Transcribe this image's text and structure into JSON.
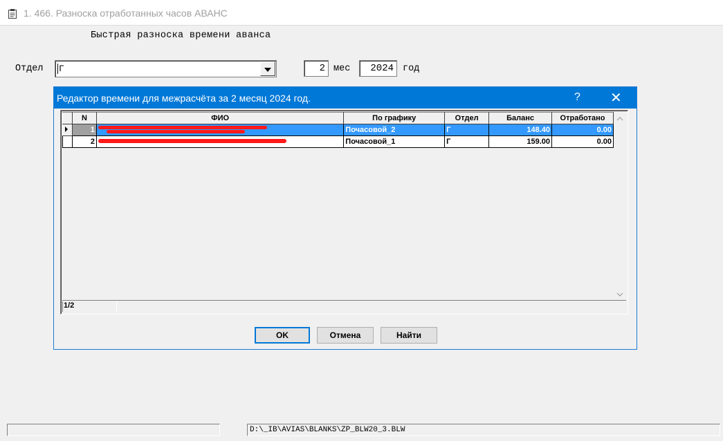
{
  "window": {
    "title": "1. 466. Разноска отработанных часов АВАНС",
    "icon": "document-icon"
  },
  "form": {
    "heading": "Быстрая разноска времени аванса",
    "dept_label": "Отдел",
    "dept_value": "Г",
    "month_value": "2",
    "month_label": "мес",
    "year_value": "2024",
    "year_label": "год"
  },
  "dialog": {
    "title": "Редактор времени для межрасчёта за 2 месяц 2024 год.",
    "help": "?",
    "close": "✕",
    "columns": [
      "N",
      "ФИО",
      "По графику",
      "Отдел",
      "Баланс",
      "Отработано"
    ],
    "rows": [
      {
        "n": "1",
        "fio": "",
        "schedule": "Почасовой_2",
        "dept": "Г",
        "balance": "148.40",
        "worked": "0.00"
      },
      {
        "n": "2",
        "fio": "",
        "schedule": "Почасовой_1",
        "dept": "Г",
        "balance": "159.00",
        "worked": "0.00"
      }
    ],
    "record_counter": "1/2",
    "buttons": {
      "ok": "OK",
      "cancel": "Отмена",
      "find": "Найти"
    }
  },
  "status": {
    "path": "D:\\_IB\\AVIAS\\BLANKS\\ZP_BLW20_3.BLW"
  },
  "colors": {
    "title_active": "#0078d7",
    "selection": "#3399ff",
    "redaction": "#ff1a1a"
  }
}
